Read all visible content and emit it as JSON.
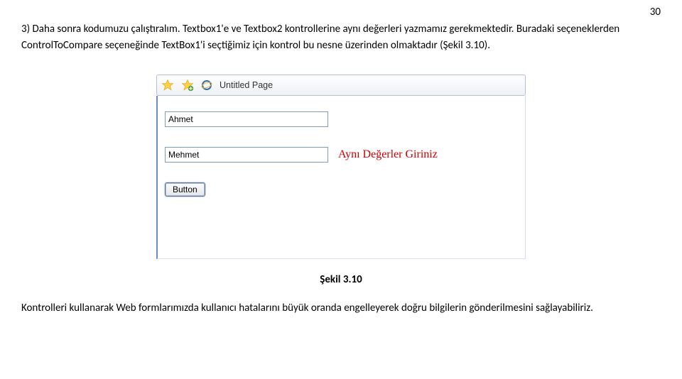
{
  "page_number": "30",
  "paragraph_text": "3)  Daha sonra kodumuzu çalıştıralım. Textbox1'e ve Textbox2 kontrollerine aynı değerleri yazmamız gerekmektedir. Buradaki seçeneklerden ControlToCompare seçeneğinde TextBox1'i  seçtiğimiz için kontrol bu nesne üzerinden olmaktadır (Şekil 3.10).",
  "browser": {
    "tab_title": "Untitled Page",
    "input1_value": "Ahmet",
    "input2_value": "Mehmet",
    "validation_message": "Aynı Değerler Giriniz",
    "button_label": "Button"
  },
  "figure_caption": "Şekil 3.10",
  "closing_text": "Kontrolleri kullanarak Web formlarımızda kullanıcı hatalarını büyük oranda engelleyerek doğru bilgilerin gönderilmesini sağlayabiliriz."
}
